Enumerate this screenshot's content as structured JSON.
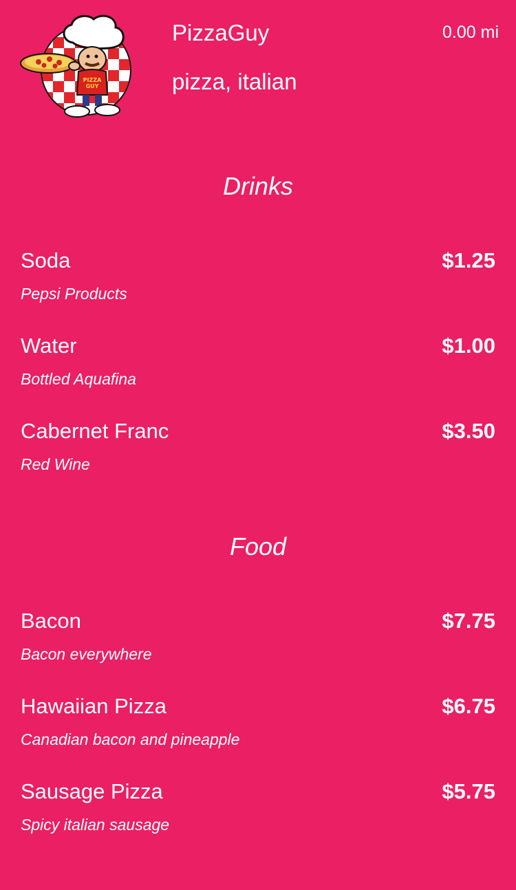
{
  "restaurant": {
    "name": "PizzaGuy",
    "categories": "pizza, italian",
    "distance": "0.00 mi",
    "logo_text": "PIZZA GUY"
  },
  "colors": {
    "background": "#EB1F63",
    "text": "#FFFFFF"
  },
  "menu": {
    "sections": [
      {
        "title": "Drinks",
        "items": [
          {
            "name": "Soda",
            "price": "$1.25",
            "description": "Pepsi Products"
          },
          {
            "name": "Water",
            "price": "$1.00",
            "description": "Bottled Aquafina"
          },
          {
            "name": "Cabernet Franc",
            "price": "$3.50",
            "description": "Red Wine"
          }
        ]
      },
      {
        "title": "Food",
        "items": [
          {
            "name": "Bacon",
            "price": "$7.75",
            "description": "Bacon everywhere"
          },
          {
            "name": "Hawaiian Pizza",
            "price": "$6.75",
            "description": "Canadian bacon and pineapple"
          },
          {
            "name": "Sausage Pizza",
            "price": "$5.75",
            "description": "Spicy italian sausage"
          }
        ]
      }
    ]
  }
}
